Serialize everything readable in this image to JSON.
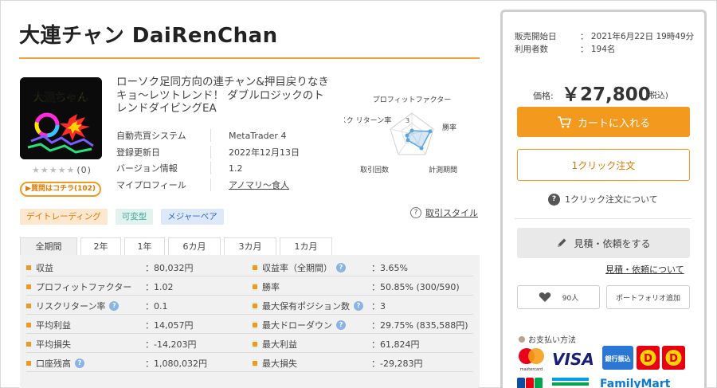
{
  "product": {
    "title": "大連チャン DaiRenChan",
    "icon_text": "大連ちゃん",
    "rating_stars": "★★★★★",
    "rating_count": "(0)",
    "buyers_pill": "▶買問はコチラ(102)",
    "description": "ローソク足同方向の連チャン&押目戻りなきキョ～レツトレンド！ ダブルロジックのトレンドダイビングEA"
  },
  "info": [
    {
      "label": "自動売買システム",
      "value": "MetaTrader 4"
    },
    {
      "label": "登録更新日",
      "value": "2022年12月13日"
    },
    {
      "label": "バージョン情報",
      "value": "1.2"
    },
    {
      "label": "マイプロフィール",
      "value": "アノマリ～食人"
    }
  ],
  "radar": {
    "labels": {
      "top": "プロフィットファクター",
      "right": "勝率",
      "bottom_right": "計測期間",
      "bottom_left": "取引回数",
      "left": "リスク リターン率"
    },
    "scale_label": "3"
  },
  "tags": [
    "デイトレーディング",
    "可変型",
    "メジャーペア"
  ],
  "trade_style_label": "取引スタイル",
  "tabs": [
    "全期間",
    "2年",
    "1年",
    "6カ月",
    "3カ月",
    "1カ月"
  ],
  "stats": [
    {
      "l_label": "収益",
      "l_value": "：80,032円",
      "r_label": "収益率（全期間）",
      "r_value": "：3.65%"
    },
    {
      "l_label": "プロフィットファクター",
      "l_value": "：1.02",
      "r_label": "勝率",
      "r_value": "：50.85% (300/590)"
    },
    {
      "l_label": "リスクリターン率",
      "l_value": "：0.1",
      "r_label": "最大保有ポジション数",
      "r_value": "：3"
    },
    {
      "l_label": "平均利益",
      "l_value": "：14,057円",
      "r_label": "最大ドローダウン",
      "r_value": "：29.75% (835,588円)"
    },
    {
      "l_label": "平均損失",
      "l_value": "：-14,203円",
      "r_label": "最大利益",
      "r_value": "：61,824円"
    },
    {
      "l_label": "口座残高",
      "l_value": "：1,080,032円",
      "r_label": "最大損失",
      "r_value": "：-29,283円"
    }
  ],
  "side": {
    "sale_start_label": "販売開始日",
    "sale_start_value": "：  2021年6月22日 19時49分",
    "users_label": "利用者数",
    "users_value": "：  194名",
    "price_label": "価格:",
    "price_value": "￥27,800",
    "price_tax": "(税込)",
    "cart_label": "カートに入れる",
    "oneclick_label": "1クリック注文",
    "oneclick_about": "1クリック注文について",
    "quote_label": "見積・依頼をする",
    "quote_link": "見積・依頼について",
    "like_count": "90人",
    "portfolio_label": "ポートフォリオ追加",
    "payment_title": "お支払い方法",
    "payment_logos": {
      "mastercard": "mastercard",
      "visa": "VISA",
      "bank": "銀行振込",
      "familymart": "FamilyMart"
    }
  },
  "colors": {
    "accent_orange": "#f39a1e",
    "tag_orange_bg": "#fde7cf",
    "tag_green_bg": "#e1f2ef",
    "tag_blue_bg": "#dde8f8",
    "radar_blue": "#5ba4e0"
  }
}
